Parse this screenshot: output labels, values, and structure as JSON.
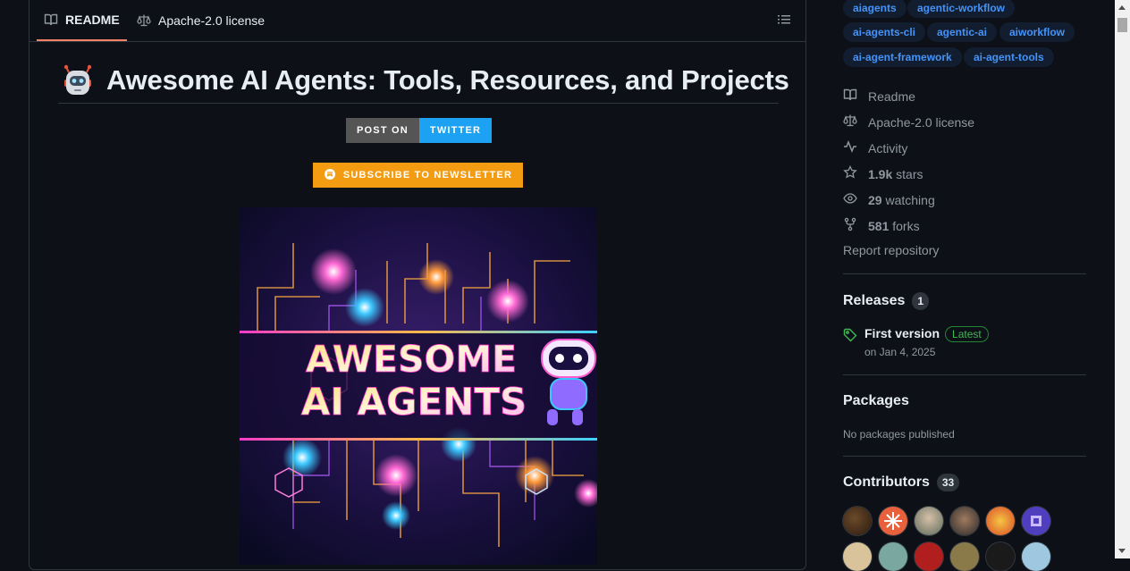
{
  "readme_tabs": {
    "readme_label": "README",
    "license_label": "Apache-2.0 license"
  },
  "readme": {
    "title": "Awesome AI Agents: Tools, Resources, and Projects",
    "post_on_label": "POST ON",
    "twitter_label": "TWITTER",
    "newsletter_label": "SUBSCRIBE TO NEWSLETTER",
    "hero_text_line1": "AWESOME",
    "hero_text_line2": "AI AGENTS"
  },
  "sidebar": {
    "topics": [
      "aiagents",
      "agentic-workflow",
      "ai-agents-cli",
      "agentic-ai",
      "aiworkflow",
      "ai-agent-framework",
      "ai-agent-tools"
    ],
    "readme_link": "Readme",
    "license_link": "Apache-2.0 license",
    "activity_link": "Activity",
    "stars_count": "1.9k",
    "stars_label": "stars",
    "watching_count": "29",
    "watching_label": "watching",
    "forks_count": "581",
    "forks_label": "forks",
    "report_link": "Report repository",
    "releases_title": "Releases",
    "releases_count": "1",
    "release_name": "First version",
    "release_badge": "Latest",
    "release_date": "on Jan 4, 2025",
    "packages_title": "Packages",
    "packages_text": "No packages published",
    "contributors_title": "Contributors",
    "contributors_count": "33"
  },
  "colors": {
    "accent": "#4493f8",
    "tab_underline": "#f78166",
    "twitter": "#1da1f2",
    "newsletter": "#f39c12",
    "latest_green": "#3fb950"
  }
}
